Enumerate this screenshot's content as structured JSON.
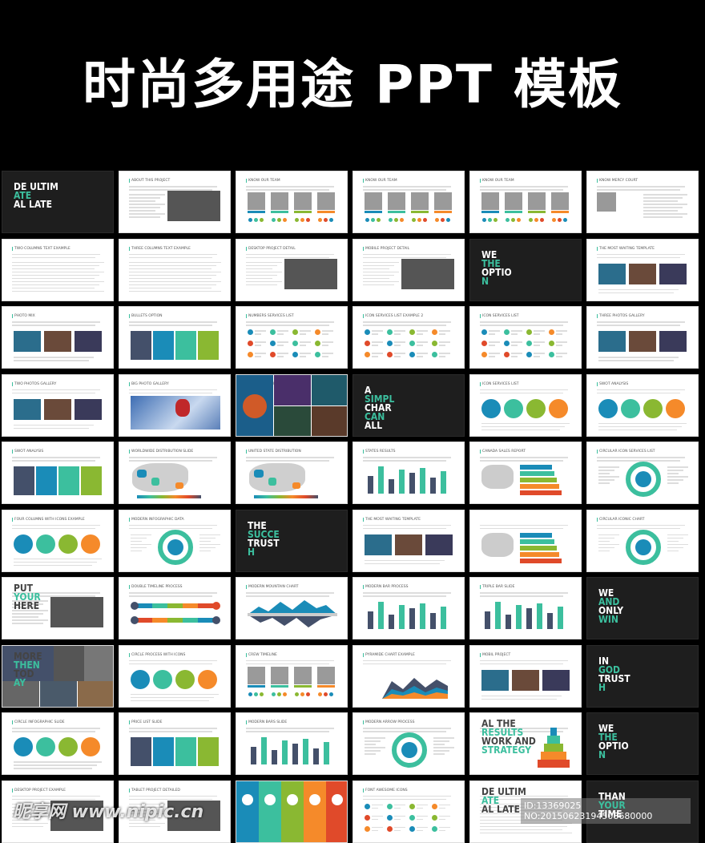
{
  "header": {
    "title": "时尚多用途 PPT 模板"
  },
  "palette": {
    "teal": "#3cbf9e",
    "blue": "#1a8cb8",
    "green": "#8ab832",
    "orange": "#f58a2a",
    "red": "#e04a2a",
    "navy": "#44506a"
  },
  "slides": [
    {
      "kind": "dark",
      "lines": [
        "DE ULTIM",
        "ATE",
        "AL LATE"
      ]
    },
    {
      "title": "ABOUT THIS PROJECT",
      "kind": "photo-right"
    },
    {
      "title": "KNOW OUR TEAM",
      "kind": "faces"
    },
    {
      "title": "KNOW OUR TEAM",
      "kind": "faces"
    },
    {
      "title": "KNOW OUR TEAM",
      "kind": "faces"
    },
    {
      "title": "KNOW MERCY COURT",
      "kind": "photo-left"
    },
    {
      "title": "TWO COLUMNS TEXT EXAMPLE",
      "kind": "text"
    },
    {
      "title": "THREE COLUMNS TEXT EXAMPLE",
      "kind": "text"
    },
    {
      "title": "DESKTOP PROJECT DETAIL",
      "kind": "photo-right"
    },
    {
      "title": "MOBILE PROJECT DETAIL",
      "kind": "photo-right"
    },
    {
      "kind": "dark",
      "lines": [
        "WE",
        "THE",
        "OPTIO",
        "N"
      ]
    },
    {
      "title": "THE MOST WAITING TEMPLATE",
      "kind": "photos"
    },
    {
      "title": "PHOTO MIX",
      "kind": "photos"
    },
    {
      "title": "BULLETS OPTION",
      "kind": "colorcols"
    },
    {
      "title": "NUMBERS SERVICES LIST",
      "kind": "icons"
    },
    {
      "title": "ICON SERVICES LIST EXAMPLE 2",
      "kind": "icons"
    },
    {
      "title": "ICON SERVICES LIST",
      "kind": "icons"
    },
    {
      "title": "THREE PHOTOS GALLERY",
      "kind": "photos"
    },
    {
      "title": "TWO PHOTOS GALLERY",
      "kind": "photos"
    },
    {
      "title": "BIG PHOTO GALLERY",
      "kind": "bigphoto"
    },
    {
      "title": "TILE PHOTO SLIDE",
      "kind": "tile"
    },
    {
      "kind": "dark",
      "lines": [
        "A",
        "SIMPL",
        "CHAR",
        "CAN",
        "ALL"
      ]
    },
    {
      "title": "ICON SERVICES LIST",
      "kind": "circles"
    },
    {
      "title": "SWOT ANALYSIS",
      "kind": "circles"
    },
    {
      "title": "SWOT ANALYSIS",
      "kind": "colorcols"
    },
    {
      "title": "WORLDWIDE DISTRIBUTION SLIDE",
      "kind": "map"
    },
    {
      "title": "UNITED STATE DISTRIBUTION",
      "kind": "map"
    },
    {
      "title": "STATES RESULTS",
      "kind": "bars"
    },
    {
      "title": "CANADA SALES REPORT",
      "kind": "hbars"
    },
    {
      "title": "CIRCULAR ICON SERVICES LIST",
      "kind": "ring"
    },
    {
      "title": "FOUR COLUMNS WITH ICONS EXAMPLE",
      "kind": "circles"
    },
    {
      "title": "MODERN INFOGRAPHIC DATA",
      "kind": "ring"
    },
    {
      "kind": "dark",
      "lines": [
        "THE",
        "SUCCE",
        "TRUST",
        "H"
      ]
    },
    {
      "title": "THE MOST WAITING TEMPLATE",
      "kind": "photos"
    },
    {
      "title": "",
      "kind": "hbars"
    },
    {
      "title": "CIRCULAR ICONIC CHART",
      "kind": "ring"
    },
    {
      "title": "",
      "kind": "photo-right",
      "lines": [
        "PUT",
        "YOUR",
        "HERE"
      ]
    },
    {
      "title": "DOUBLE TIMELINE PROCESS",
      "kind": "timeline"
    },
    {
      "title": "MODERN MOUNTAIN CHART",
      "kind": "mountain"
    },
    {
      "title": "MODERN BAR PROCESS",
      "kind": "bars"
    },
    {
      "title": "TRIPLE BAR SLIDE",
      "kind": "bars"
    },
    {
      "kind": "dark",
      "lines": [
        "WE",
        "AND",
        "ONLY",
        "WIN"
      ]
    },
    {
      "title": "",
      "kind": "collage",
      "lines": [
        "MORE",
        "THEN",
        "TOD",
        "AY"
      ]
    },
    {
      "title": "CIRCLE PROCESS WITH ICONS",
      "kind": "circles"
    },
    {
      "title": "CREW TIMELINE",
      "kind": "faces"
    },
    {
      "title": "PYRAMIDE CHART EXAMPLE",
      "kind": "area"
    },
    {
      "title": "MOBIL PROJECT",
      "kind": "photos"
    },
    {
      "kind": "dark",
      "lines": [
        "IN",
        "GOD",
        "TRUST",
        "H"
      ]
    },
    {
      "title": "CIRCLE INFOGRAPHIC SLIDE",
      "kind": "circles"
    },
    {
      "title": "PRICE LIST SLIDE",
      "kind": "colorcols"
    },
    {
      "title": "MODERN BARS SLIDE",
      "kind": "bars"
    },
    {
      "title": "MODERN ARROW PROCESS",
      "kind": "ring"
    },
    {
      "title": "",
      "kind": "pyramid",
      "lines": [
        "AL THE",
        "RESULTS",
        "WORK AND",
        "STRATEGY"
      ]
    },
    {
      "kind": "dark",
      "lines": [
        "WE",
        "THE",
        "OPTIO",
        "N"
      ]
    },
    {
      "title": "DESKTOP PROJECT EXAMPLE",
      "kind": "photo-right"
    },
    {
      "title": "TABLET PROJECT DETAILED",
      "kind": "photo-right"
    },
    {
      "title": "",
      "kind": "fullcols"
    },
    {
      "title": "FONT AWESOME ICONS",
      "kind": "icons"
    },
    {
      "title": "",
      "kind": "text",
      "lines": [
        "DE ULTIM",
        "ATE",
        "AL LATE"
      ]
    },
    {
      "kind": "dark",
      "lines": [
        "THAN",
        "YOUR",
        "TIME"
      ]
    }
  ],
  "watermark": {
    "site": "昵享网 www.nipic.cn",
    "id": "ID:13369025 NO:20150623194508680000"
  }
}
